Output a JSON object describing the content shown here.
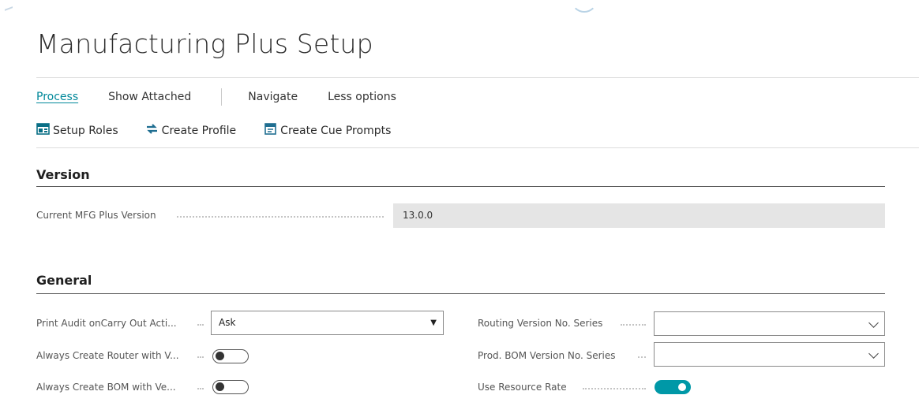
{
  "page": {
    "title": "Manufacturing Plus Setup"
  },
  "action_bar": {
    "tabs": [
      {
        "label": "Process",
        "active": true
      },
      {
        "label": "Show Attached",
        "active": false
      },
      {
        "label": "Navigate",
        "active": false
      },
      {
        "label": "Less options",
        "active": false
      }
    ]
  },
  "commands": [
    {
      "label": "Setup Roles",
      "icon": "setup-roles-icon"
    },
    {
      "label": "Create Profile",
      "icon": "create-profile-icon"
    },
    {
      "label": "Create Cue Prompts",
      "icon": "create-cue-prompts-icon"
    }
  ],
  "version_section": {
    "title": "Version",
    "current_version_label": "Current MFG Plus Version",
    "current_version_value": "13.0.0"
  },
  "general_section": {
    "title": "General",
    "print_audit": {
      "label": "Print Audit onCarry Out Acti...",
      "value": "Ask"
    },
    "always_create_router": {
      "label": "Always Create Router with V...",
      "value": false
    },
    "always_create_bom": {
      "label": "Always Create BOM with Ve...",
      "value": false
    },
    "routing_version_series": {
      "label": "Routing Version No. Series",
      "value": ""
    },
    "prod_bom_version_series": {
      "label": "Prod. BOM Version No. Series",
      "value": ""
    },
    "use_resource_rate": {
      "label": "Use Resource Rate",
      "value": true
    }
  },
  "colors": {
    "accent": "#00889a",
    "toggle_on": "#0098a7"
  }
}
